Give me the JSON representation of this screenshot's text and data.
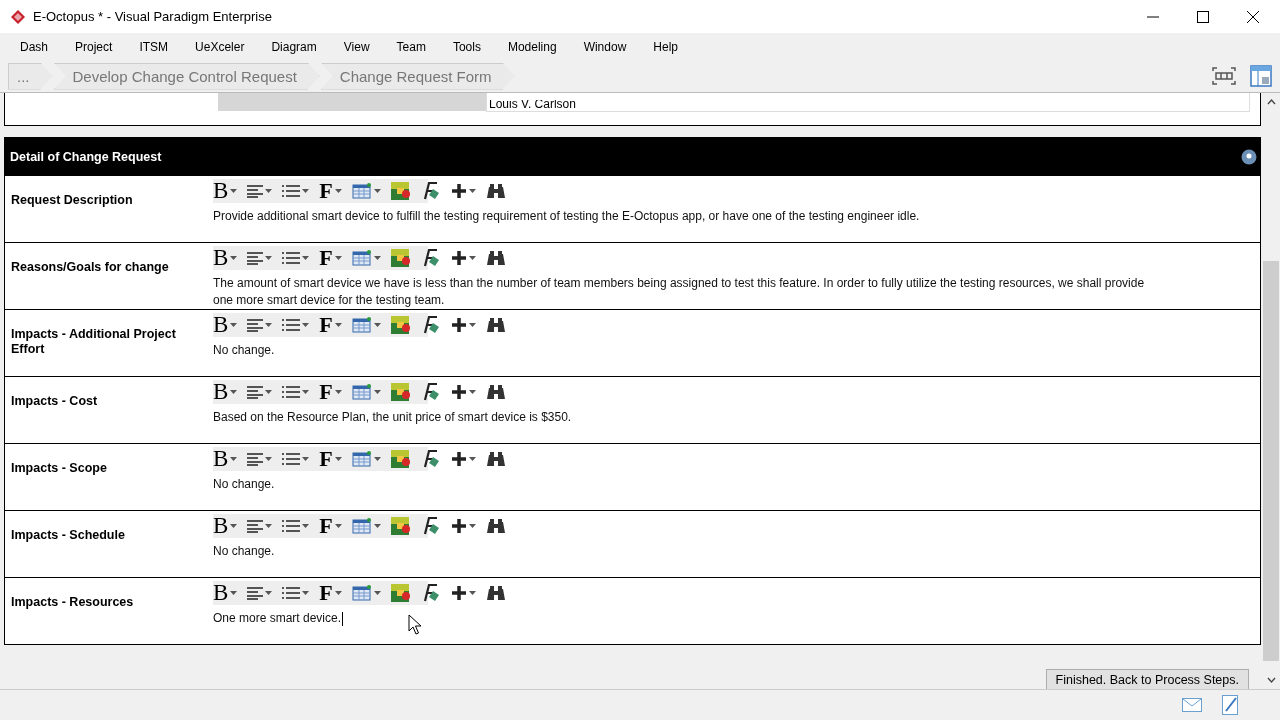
{
  "window": {
    "title": "E-Octopus * - Visual Paradigm Enterprise"
  },
  "menu": [
    "Dash",
    "Project",
    "ITSM",
    "UeXceler",
    "Diagram",
    "View",
    "Team",
    "Tools",
    "Modeling",
    "Window",
    "Help"
  ],
  "breadcrumb": [
    "...",
    "Develop Change Control Request",
    "Change Request Form"
  ],
  "partial_row": {
    "value": "Louis V. Carlson"
  },
  "section": {
    "title": "Detail of Change Request"
  },
  "fields": [
    {
      "bold_glyph": "B",
      "font_glyph": "F",
      "label": "Request Description",
      "text": "Provide additional smart device to fulfill the testing requirement of testing the E-Octopus app, or have one of the testing engineer idle.",
      "focused": false
    },
    {
      "bold_glyph": "B",
      "font_glyph": "F",
      "label": "Reasons/Goals for change",
      "text": "The amount of smart device we have is less than the number of team members being assigned to test this feature. In order to fully utilize the testing resources, we shall provide one more smart device for the testing team.",
      "focused": false
    },
    {
      "bold_glyph": "B",
      "font_glyph": "F",
      "label": "Impacts - Additional Project Effort",
      "text": "No change.",
      "focused": false
    },
    {
      "bold_glyph": "B",
      "font_glyph": "F",
      "label": "Impacts - Cost",
      "text": "Based on the Resource Plan, the unit price of smart device is $350.",
      "focused": false
    },
    {
      "bold_glyph": "B",
      "font_glyph": "F",
      "label": "Impacts - Scope",
      "text": "No change.",
      "focused": false
    },
    {
      "bold_glyph": "B",
      "font_glyph": "F",
      "label": "Impacts - Schedule",
      "text": "No change.",
      "focused": false
    },
    {
      "bold_glyph": "B",
      "font_glyph": "F",
      "label": "Impacts - Resources",
      "text": "One more smart device.",
      "focused": true
    }
  ],
  "finish_button": "Finished. Back to Process Steps."
}
